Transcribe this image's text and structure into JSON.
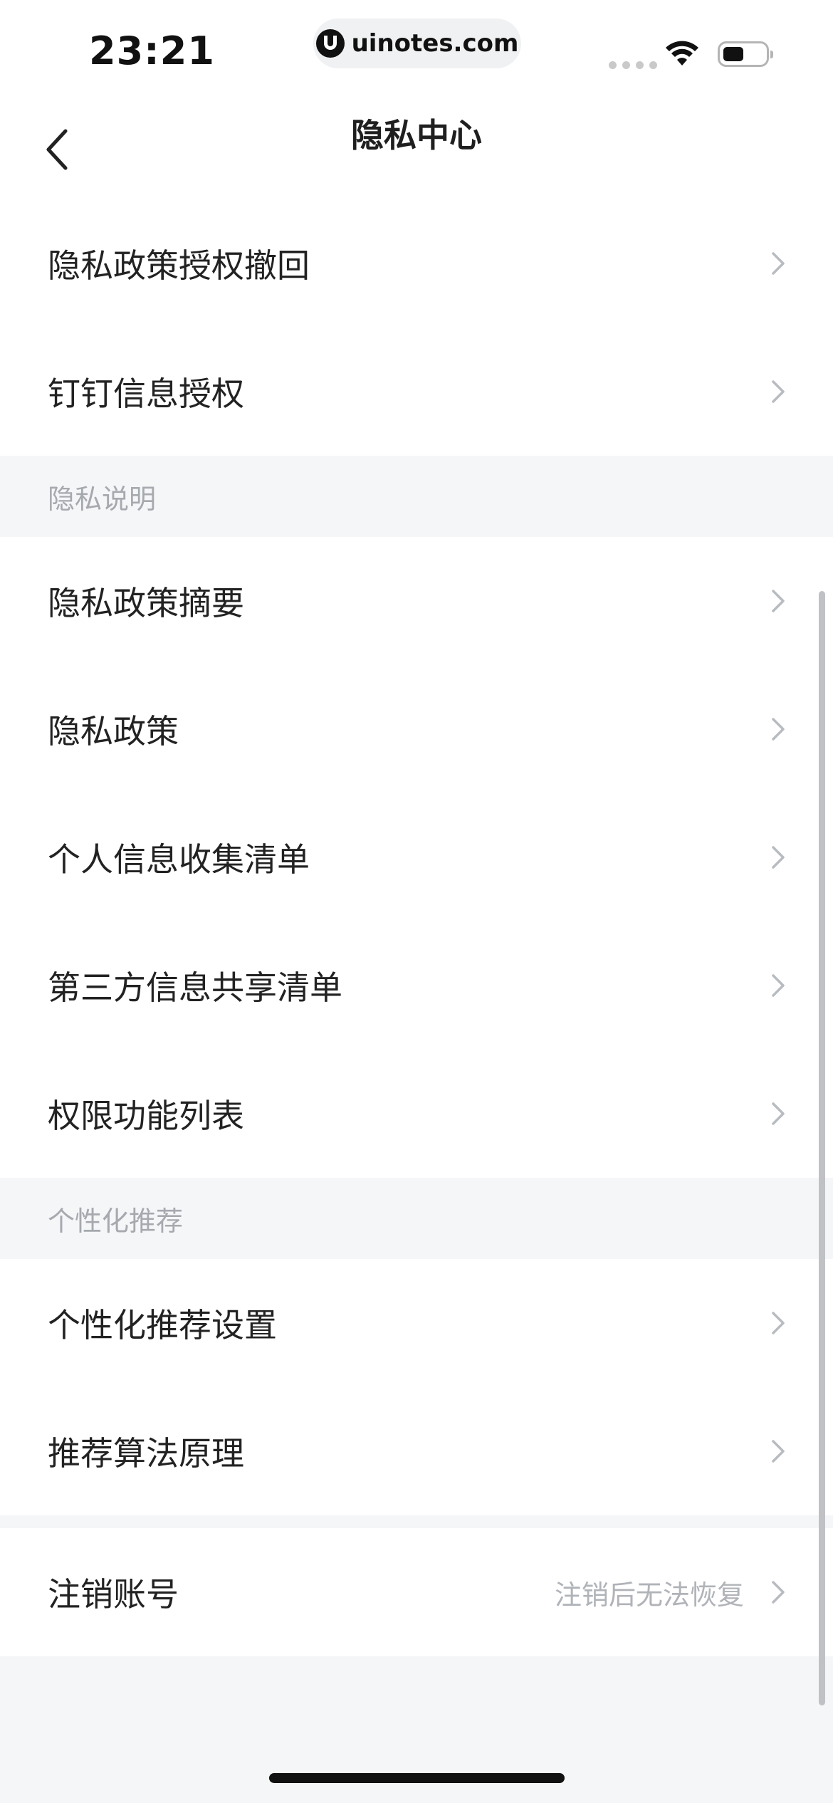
{
  "status_bar": {
    "time": "23:21",
    "watermark": "uinotes.com",
    "icons": [
      "signal-dots-icon",
      "wifi-icon",
      "battery-icon"
    ]
  },
  "nav": {
    "title": "隐私中心",
    "back_icon": "chevron-left-icon"
  },
  "group_top": [
    {
      "label": "隐私政策授权撤回"
    },
    {
      "label": "钉钉信息授权"
    }
  ],
  "section_privacy": {
    "title": "隐私说明",
    "items": [
      {
        "label": "隐私政策摘要"
      },
      {
        "label": "隐私政策"
      },
      {
        "label": "个人信息收集清单"
      },
      {
        "label": "第三方信息共享清单"
      },
      {
        "label": "权限功能列表"
      }
    ]
  },
  "section_recommend": {
    "title": "个性化推荐",
    "items": [
      {
        "label": "个性化推荐设置"
      },
      {
        "label": "推荐算法原理"
      }
    ]
  },
  "account": {
    "label": "注销账号",
    "hint": "注销后无法恢复"
  },
  "colors": {
    "background": "#f5f6f8",
    "card": "#ffffff",
    "text": "#222222",
    "muted": "#a6a9ae",
    "chevron": "#b8bbc0"
  }
}
